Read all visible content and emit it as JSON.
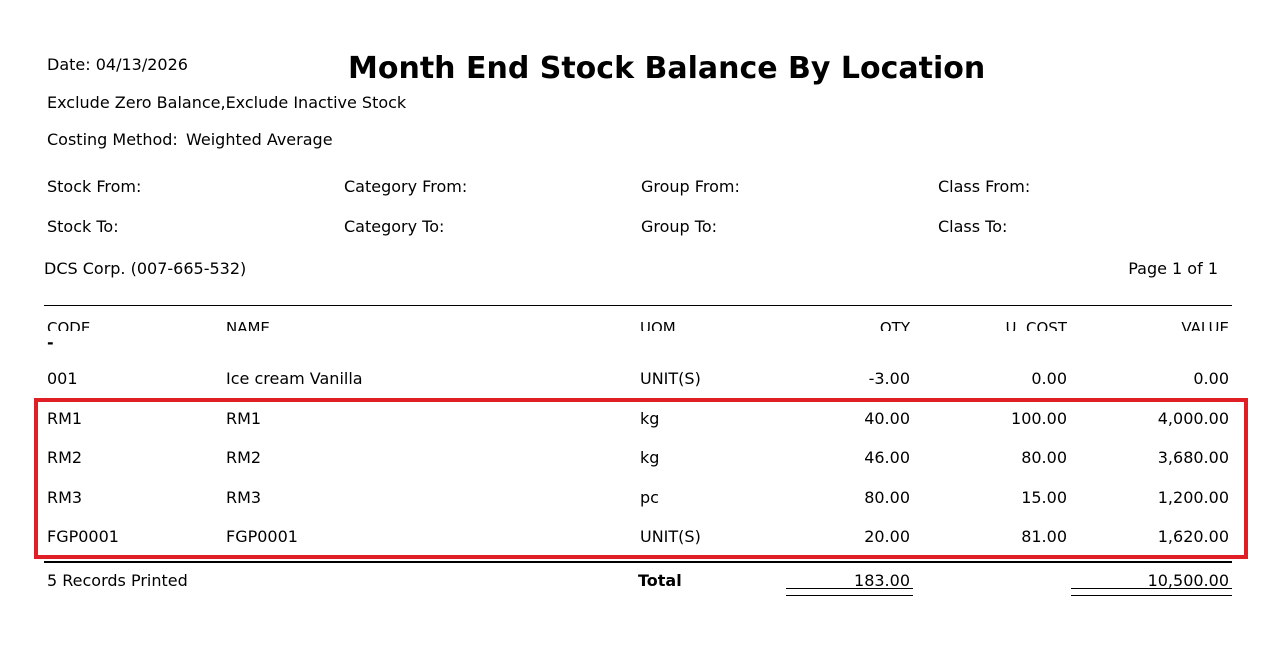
{
  "report": {
    "date_label": "Date: 04/13/2026",
    "title": "Month End Stock Balance By Location",
    "filter_line": "Exclude Zero Balance,Exclude Inactive Stock",
    "costing_label": "Costing Method:",
    "costing_value": "Weighted Average",
    "ranges": {
      "stock_from": "Stock From:",
      "stock_to": "Stock To:",
      "category_from": "Category From:",
      "category_to": "Category To:",
      "group_from": "Group From:",
      "group_to": "Group To:",
      "class_from": "Class From:",
      "class_to": "Class To:"
    },
    "company": "DCS Corp. (007-665-532)",
    "page": "Page 1 of 1"
  },
  "table": {
    "headers": {
      "code": "CODE",
      "name": "NAME",
      "uom": "UOM",
      "qty": "QTY",
      "ucost": "U. COST",
      "value": "VALUE"
    },
    "dash": "-",
    "rows": [
      {
        "code": "001",
        "name": "Ice cream Vanilla",
        "uom": "UNIT(S)",
        "qty": "-3.00",
        "ucost": "0.00",
        "value": "0.00"
      },
      {
        "code": "RM1",
        "name": "RM1",
        "uom": "kg",
        "qty": "40.00",
        "ucost": "100.00",
        "value": "4,000.00"
      },
      {
        "code": "RM2",
        "name": "RM2",
        "uom": "kg",
        "qty": "46.00",
        "ucost": "80.00",
        "value": "3,680.00"
      },
      {
        "code": "RM3",
        "name": "RM3",
        "uom": "pc",
        "qty": "80.00",
        "ucost": "15.00",
        "value": "1,200.00"
      },
      {
        "code": "FGP0001",
        "name": "FGP0001",
        "uom": "UNIT(S)",
        "qty": "20.00",
        "ucost": "81.00",
        "value": "1,620.00"
      }
    ],
    "footer": {
      "records": "5 Records Printed",
      "total_label": "Total",
      "total_qty": "183.00",
      "total_value": "10,500.00"
    }
  },
  "colors": {
    "highlight_border": "#e01e26"
  }
}
